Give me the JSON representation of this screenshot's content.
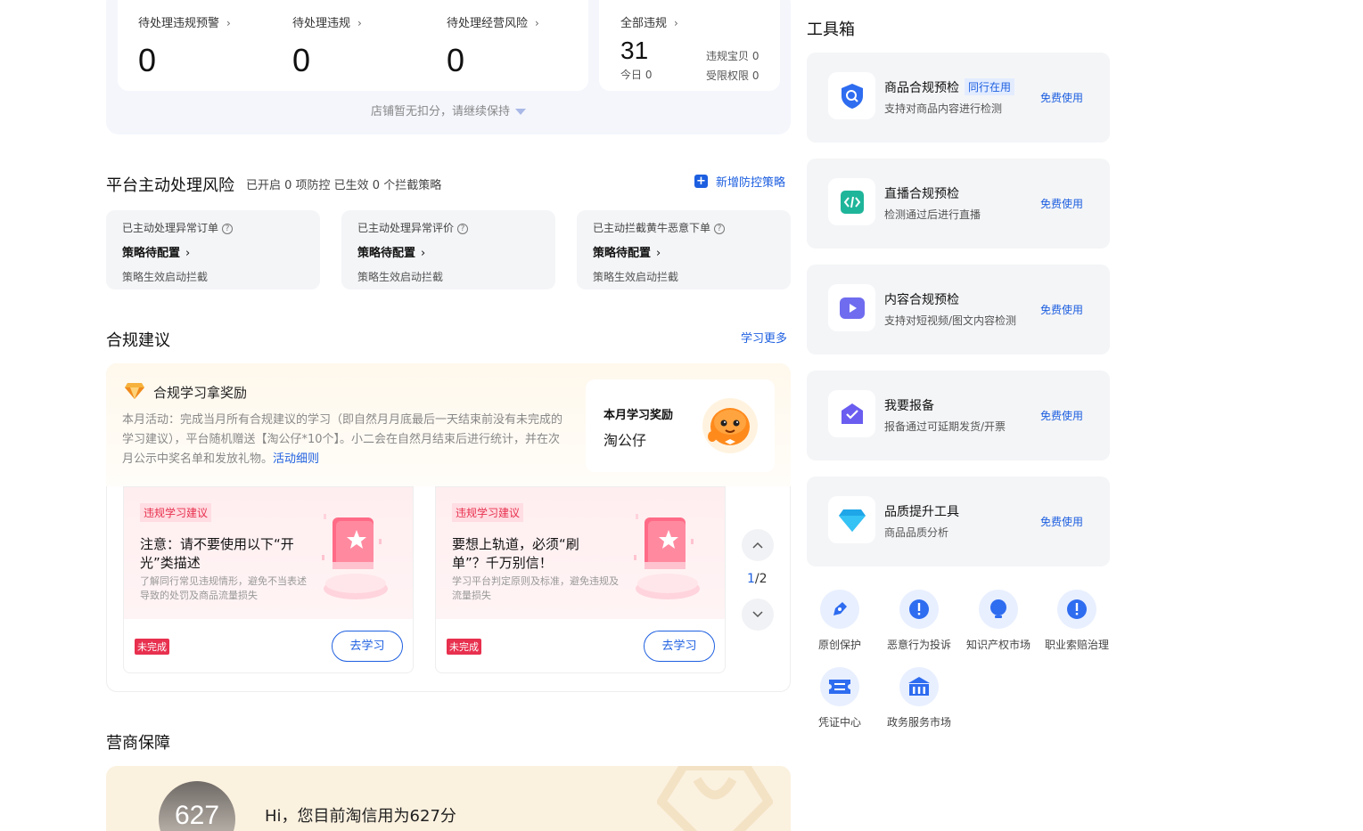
{
  "stats": {
    "items": [
      {
        "label": "待处理违规预警",
        "value": "0"
      },
      {
        "label": "待处理违规",
        "value": "0"
      },
      {
        "label": "待处理经营风险",
        "value": "0"
      }
    ],
    "all": {
      "label": "全部违规",
      "value": "31",
      "today": "今日 0",
      "baby": "违规宝贝 0",
      "limit": "受限权限 0"
    },
    "footer": "店铺暂无扣分，请继续保持",
    "chevron": "›"
  },
  "risk": {
    "title": "平台主动处理风险",
    "subtitle": "已开启 0 项防控 已生效 0 个拦截策略",
    "add_label": "新增防控策略",
    "cards": [
      {
        "title": "已主动处理异常订单",
        "status": "策略待配置",
        "desc": "策略生效启动拦截"
      },
      {
        "title": "已主动处理异常评价",
        "status": "策略待配置",
        "desc": "策略生效启动拦截"
      },
      {
        "title": "已主动拦截黄牛恶意下单",
        "status": "策略待配置",
        "desc": "策略生效启动拦截"
      }
    ],
    "qmark": "?"
  },
  "compliance": {
    "title": "合规建议",
    "more": "学习更多",
    "reward_title": "合规学习拿奖励",
    "description": "本月活动：完成当月所有合规建议的学习（即自然月月底最后一天结束前没有未完成的学习建议），平台随机赠送【淘公仔*10个】。小二会在自然月结束后进行统计，并在次月公示中奖名单和发放礼物。",
    "rules_link": "活动细则",
    "monthly_label": "本月学习奖励",
    "monthly_value": "淘公仔",
    "cards": [
      {
        "tag": "违规学习建议",
        "title": "注意：请不要使用以下“开光”类描述",
        "desc": "了解同行常见违规情形，避免不当表述导致的处罚及商品流量损失",
        "status": "未完成",
        "button": "去学习"
      },
      {
        "tag": "违规学习建议",
        "title": "要想上轨道，必须“刷单”？千万别信！",
        "desc": "学习平台判定原则及标准，避免违规及流量损失",
        "status": "未完成",
        "button": "去学习"
      }
    ],
    "page_current": "1",
    "page_total": "/2"
  },
  "credit": {
    "title": "营商保障",
    "score": "627",
    "text": "Hi，您目前淘信用为627分"
  },
  "toolbox": {
    "title": "工具箱",
    "tools": [
      {
        "name": "商品合规预检",
        "tag": "同行在用",
        "desc": "支持对商品内容进行检测",
        "action": "免费使用",
        "icon": "shield-search-icon",
        "color": "#2e6cf0"
      },
      {
        "name": "直播合规预检",
        "tag": "",
        "desc": "检测通过后进行直播",
        "action": "免费使用",
        "icon": "code-icon",
        "color": "#1fb59a"
      },
      {
        "name": "内容合规预检",
        "tag": "",
        "desc": "支持对短视频/图文内容检测",
        "action": "免费使用",
        "icon": "video-icon",
        "color": "#6f6cf0"
      },
      {
        "name": "我要报备",
        "tag": "",
        "desc": "报备通过可延期发货/开票",
        "action": "免费使用",
        "icon": "check-envelope-icon",
        "color": "#6a5df0"
      },
      {
        "name": "品质提升工具",
        "tag": "",
        "desc": "商品品质分析",
        "action": "免费使用",
        "icon": "diamond-icon",
        "color": "#1fa6e8"
      }
    ],
    "quick": [
      {
        "label": "原创保护",
        "icon": "pen-icon"
      },
      {
        "label": "恶意行为投诉",
        "icon": "alert-icon"
      },
      {
        "label": "知识产权市场",
        "icon": "bulb-icon"
      },
      {
        "label": "职业索赔治理",
        "icon": "alert-icon"
      },
      {
        "label": "凭证中心",
        "icon": "ticket-icon"
      },
      {
        "label": "政务服务市场",
        "icon": "building-icon"
      }
    ]
  }
}
